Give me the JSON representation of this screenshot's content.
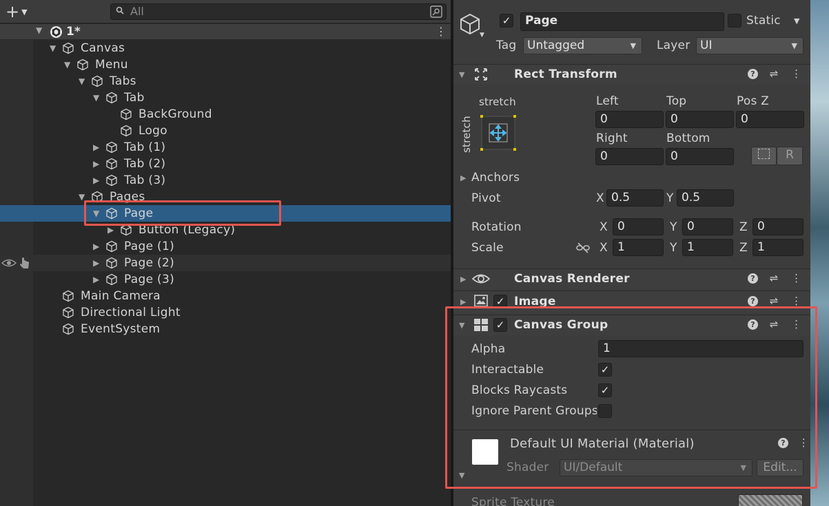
{
  "hierarchy": {
    "search_placeholder": "All",
    "add_label": "+",
    "scene": "1*",
    "items": [
      {
        "label": "Canvas",
        "depth": 0,
        "expand": "open"
      },
      {
        "label": "Menu",
        "depth": 1,
        "expand": "open"
      },
      {
        "label": "Tabs",
        "depth": 2,
        "expand": "open"
      },
      {
        "label": "Tab",
        "depth": 3,
        "expand": "open"
      },
      {
        "label": "BackGround",
        "depth": 4,
        "expand": "none"
      },
      {
        "label": "Logo",
        "depth": 4,
        "expand": "none"
      },
      {
        "label": "Tab (1)",
        "depth": 3,
        "expand": "closed"
      },
      {
        "label": "Tab (2)",
        "depth": 3,
        "expand": "closed"
      },
      {
        "label": "Tab (3)",
        "depth": 3,
        "expand": "closed"
      },
      {
        "label": "Pages",
        "depth": 2,
        "expand": "open"
      },
      {
        "label": "Page",
        "depth": 3,
        "expand": "open",
        "selected": true
      },
      {
        "label": "Button (Legacy)",
        "depth": 4,
        "expand": "closed"
      },
      {
        "label": "Page (1)",
        "depth": 3,
        "expand": "closed"
      },
      {
        "label": "Page (2)",
        "depth": 3,
        "expand": "closed",
        "hover": true
      },
      {
        "label": "Page (3)",
        "depth": 3,
        "expand": "closed"
      },
      {
        "label": "Main Camera",
        "depth": 0,
        "expand": "none"
      },
      {
        "label": "Directional Light",
        "depth": 0,
        "expand": "none"
      },
      {
        "label": "EventSystem",
        "depth": 0,
        "expand": "none"
      }
    ]
  },
  "inspector": {
    "object_name": "Page",
    "static_label": "Static",
    "tag_label": "Tag",
    "tag_value": "Untagged",
    "layer_label": "Layer",
    "layer_value": "UI",
    "rect_transform": {
      "title": "Rect Transform",
      "anchor_h": "stretch",
      "anchor_v": "stretch",
      "left_label": "Left",
      "left": "0",
      "top_label": "Top",
      "top": "0",
      "posz_label": "Pos Z",
      "posz": "0",
      "right_label": "Right",
      "right": "0",
      "bottom_label": "Bottom",
      "bottom": "0",
      "r_button": "R",
      "anchors_label": "Anchors",
      "pivot_label": "Pivot",
      "pivot_x": "0.5",
      "pivot_y": "0.5",
      "rotation_label": "Rotation",
      "rot_x": "0",
      "rot_y": "0",
      "rot_z": "0",
      "scale_label": "Scale",
      "scale_x": "1",
      "scale_y": "1",
      "scale_z": "1",
      "x": "X",
      "y": "Y",
      "z": "Z"
    },
    "canvas_renderer": {
      "title": "Canvas Renderer"
    },
    "image": {
      "title": "Image"
    },
    "canvas_group": {
      "title": "Canvas Group",
      "alpha_label": "Alpha",
      "alpha": "1",
      "interactable_label": "Interactable",
      "interactable": true,
      "blocks_label": "Blocks Raycasts",
      "blocks": true,
      "ignore_label": "Ignore Parent Groups",
      "ignore": false
    },
    "material": {
      "title": "Default UI Material (Material)",
      "shader_label": "Shader",
      "shader_value": "UI/Default",
      "edit_label": "Edit..."
    },
    "sprite_texture_label": "Sprite Texture"
  },
  "colors": {
    "selection": "#2c5d87",
    "highlight": "#e4554f",
    "panel": "#3c3c3c",
    "hierarchy_bg": "#282828"
  }
}
